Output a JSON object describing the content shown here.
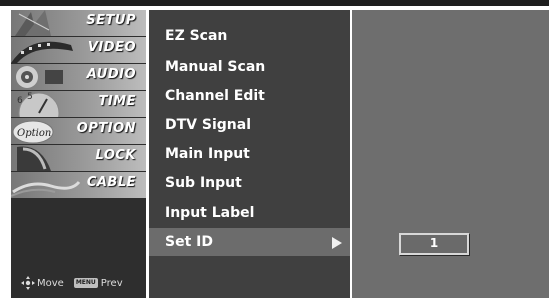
{
  "sidebar": {
    "categories": [
      {
        "label": "SETUP",
        "icon": "satellite-dish-icon"
      },
      {
        "label": "VIDEO",
        "icon": "film-reel-icon"
      },
      {
        "label": "AUDIO",
        "icon": "speaker-icon"
      },
      {
        "label": "TIME",
        "icon": "clock-icon"
      },
      {
        "label": "OPTION",
        "icon": "option-tag-icon"
      },
      {
        "label": "LOCK",
        "icon": "padlock-icon"
      },
      {
        "label": "CABLE",
        "icon": "cable-icon"
      }
    ],
    "legend": {
      "move_label": "Move",
      "menu_key": "MENU",
      "prev_label": "Prev"
    }
  },
  "menu": {
    "items": [
      {
        "label": "EZ Scan"
      },
      {
        "label": "Manual Scan"
      },
      {
        "label": "Channel Edit"
      },
      {
        "label": "DTV Signal"
      },
      {
        "label": "Main Input"
      },
      {
        "label": "Sub Input"
      },
      {
        "label": "Input Label"
      },
      {
        "label": "Set ID"
      }
    ],
    "selected": "Set ID"
  },
  "panel": {
    "set_id_value": "1"
  },
  "colors": {
    "sidebar_bg": "#2e2e2e",
    "menu_bg": "#404040",
    "selected_bg": "#6c6c6c",
    "panel_bg": "#6e6e6e"
  }
}
